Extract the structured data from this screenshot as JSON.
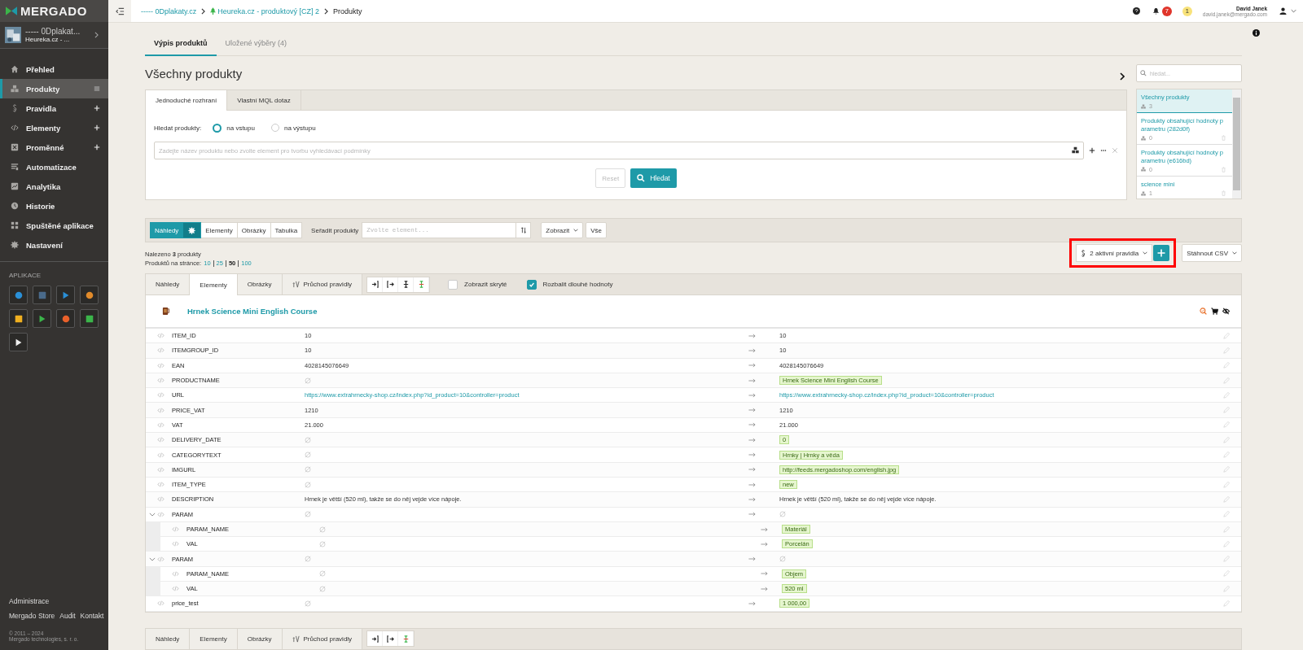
{
  "sidebar": {
    "logo": "MERGADO",
    "project": {
      "name": "----- 0Dplakat...",
      "feed": "Heureka.cz - ..."
    },
    "nav": [
      {
        "label": "Přehled",
        "selected": false,
        "kind": "plain"
      },
      {
        "label": "Produkty",
        "selected": true,
        "kind": "list"
      },
      {
        "label": "Pravidla",
        "selected": false,
        "kind": "add"
      },
      {
        "label": "Elementy",
        "selected": false,
        "kind": "add"
      },
      {
        "label": "Proměnné",
        "selected": false,
        "kind": "add"
      },
      {
        "label": "Automatizace",
        "selected": false,
        "kind": "plain"
      },
      {
        "label": "Analytika",
        "selected": false,
        "kind": "plain"
      },
      {
        "label": "Historie",
        "selected": false,
        "kind": "plain"
      },
      {
        "label": "Spuštěné aplikace",
        "selected": false,
        "kind": "plain"
      },
      {
        "label": "Nastavení",
        "selected": false,
        "kind": "plain"
      }
    ],
    "apps_heading": "APLIKACE",
    "footer": {
      "admin": "Administrace",
      "links": [
        "Mergado Store",
        "Audit",
        "Kontakt"
      ],
      "copyright": "© 2011 – 2024",
      "company": "Mergado technologies, s. r. o."
    }
  },
  "breadcrumb": [
    {
      "label": "----- 0Dplakaty.cz",
      "kind": "project"
    },
    {
      "label": "Heureka.cz - produktový [CZ] 2",
      "kind": "export"
    },
    {
      "label": "Produkty",
      "kind": "current"
    }
  ],
  "user": {
    "name": "David Janek",
    "email": "david.janek@mergado.com",
    "notifications": "7",
    "warnings": "1"
  },
  "page_tabs": [
    {
      "label": "Výpis produktů",
      "selected": true
    },
    {
      "label": "Uložené výběry (4)",
      "selected": false
    }
  ],
  "title": "Všechny produkty",
  "search": {
    "tabs": [
      {
        "label": "Jednoduché rozhraní",
        "selected": true
      },
      {
        "label": "Vlastní MQL dotaz",
        "selected": false
      }
    ],
    "scope_label": "Hledat produkty:",
    "scope": [
      {
        "label": "na vstupu",
        "selected": true
      },
      {
        "label": "na výstupu",
        "selected": false
      }
    ],
    "placeholder": "Zadejte název produktu nebo zvolte element pro tvorbu vyhledávací podmínky",
    "reset": "Reset",
    "submit": "Hledat"
  },
  "saved": {
    "placeholder": "hledat...",
    "items": [
      {
        "label": "Všechny produkty",
        "count": "3",
        "selected": true,
        "deletable": false
      },
      {
        "label": "Produkty obsahující hodnoty p arametru (282d0f)",
        "count": "0",
        "selected": false,
        "deletable": true
      },
      {
        "label": "Produkty obsahující hodnoty p arametru (e616bd)",
        "count": "0",
        "selected": false,
        "deletable": true
      },
      {
        "label": "science mini",
        "count": "1",
        "selected": false,
        "deletable": true
      }
    ]
  },
  "toolbar": {
    "views": [
      {
        "label": "Náhledy",
        "selected": true
      },
      {
        "label": "Elementy",
        "selected": false
      },
      {
        "label": "Obrázky",
        "selected": false
      },
      {
        "label": "Tabulka",
        "selected": false
      }
    ],
    "sort_label": "Seřadit produkty",
    "sort_placeholder": "Zvolte element...",
    "show": "Zobrazit",
    "all": "Vše"
  },
  "found": "Nalezeno **3** produkty",
  "per_page_label": "Produktů na stránce:",
  "per_page": [
    {
      "label": "10",
      "selected": false
    },
    {
      "label": "25",
      "selected": false
    },
    {
      "label": "50",
      "selected": true
    },
    {
      "label": "100",
      "selected": false
    }
  ],
  "rules": "2 aktivní pravidla",
  "download": "Stáhnout CSV",
  "product_tabs": [
    {
      "label": "Náhledy",
      "selected": false
    },
    {
      "label": "Elementy",
      "selected": true
    },
    {
      "label": "Obrázky",
      "selected": false
    },
    {
      "label": "Průchod pravidly",
      "selected": false
    }
  ],
  "show_hidden": {
    "label": "Zobrazit skryté",
    "checked": false
  },
  "expand_long": {
    "label": "Rozbalit dlouhé hodnoty",
    "checked": true
  },
  "product": {
    "name": "Hrnek Science Mini English Course",
    "elements": [
      {
        "name": "ITEM_ID",
        "input": "10",
        "output": "10",
        "changed": false
      },
      {
        "name": "ITEMGROUP_ID",
        "input": "10",
        "output": "10",
        "changed": false
      },
      {
        "name": "EAN",
        "input": "4028145076649",
        "output": "4028145076649",
        "changed": false
      },
      {
        "name": "PRODUCTNAME",
        "output": "Hrnek Science Mini English Course",
        "changed": true
      },
      {
        "name": "URL",
        "kind": "link",
        "input": "https://www.extrahrnecky-shop.cz/index.php?id_product=10&controller=product",
        "output": "https://www.extrahrnecky-shop.cz/index.php?id_product=10&controller=product",
        "changed": false
      },
      {
        "name": "PRICE_VAT",
        "input": "1210",
        "output": "1210",
        "changed": false
      },
      {
        "name": "VAT",
        "input": "21.000",
        "output": "21.000",
        "changed": false
      },
      {
        "name": "DELIVERY_DATE",
        "output": "0",
        "changed": true
      },
      {
        "name": "CATEGORYTEXT",
        "output": "Hrnky | Hrnky a věda",
        "changed": true
      },
      {
        "name": "IMGURL",
        "output": "http://feeds.mergadoshop.com/english.jpg",
        "changed": true
      },
      {
        "name": "ITEM_TYPE",
        "output": "new",
        "changed": true
      },
      {
        "name": "DESCRIPTION",
        "input": "Hrnek je větší (520 ml), takže se do něj vejde více nápoje.",
        "output": "Hrnek je větší (520 ml), takže se do něj vejde více nápoje.",
        "changed": false
      },
      {
        "name": "PARAM",
        "expanded": true,
        "children": [
          {
            "name": "PARAM_NAME",
            "output": "Materiál",
            "changed": true
          },
          {
            "name": "VAL",
            "output": "Porcelán",
            "changed": true
          }
        ]
      },
      {
        "name": "PARAM",
        "expanded": true,
        "children": [
          {
            "name": "PARAM_NAME",
            "output": "Objem",
            "changed": true
          },
          {
            "name": "VAL",
            "output": "520 ml",
            "changed": true
          }
        ]
      },
      {
        "name": "price_test",
        "output": "1 000,00",
        "changed": true
      }
    ]
  },
  "bottom_tabs": [
    {
      "label": "Náhledy",
      "selected": false
    },
    {
      "label": "Elementy",
      "selected": false
    },
    {
      "label": "Obrázky",
      "selected": false
    },
    {
      "label": "Průchod pravidly",
      "selected": false
    }
  ]
}
